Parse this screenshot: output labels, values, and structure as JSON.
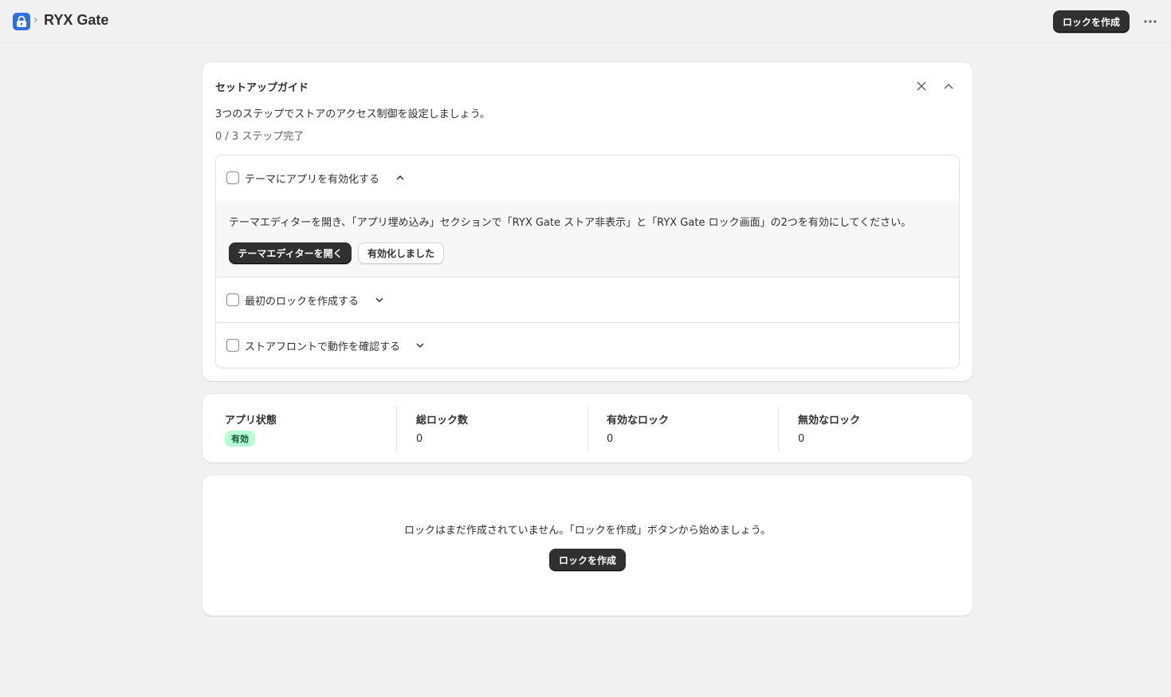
{
  "header": {
    "breadcrumb_separator": "›",
    "app_title": "RYX Gate",
    "create_lock_label": "ロックを作成",
    "more_label": "⋯"
  },
  "setup_guide": {
    "title": "セットアップガイド",
    "description": "3つのステップでストアのアクセス制御を設定しましょう。",
    "progress": "0 / 3 ステップ完了",
    "steps": [
      {
        "label": "テーマにアプリを有効化する",
        "expanded": true,
        "body": "テーマエディターを開き、「アプリ埋め込み」セクションで「RYX Gate ストア非表示」と「RYX Gate ロック画面」の2つを有効にしてください。",
        "primary_action": "テーマエディターを開く",
        "secondary_action": "有効化しました"
      },
      {
        "label": "最初のロックを作成する",
        "expanded": false
      },
      {
        "label": "ストアフロントで動作を確認する",
        "expanded": false
      }
    ]
  },
  "stats": [
    {
      "label": "アプリ状態",
      "badge": "有効"
    },
    {
      "label": "総ロック数",
      "value": "0"
    },
    {
      "label": "有効なロック",
      "value": "0"
    },
    {
      "label": "無効なロック",
      "value": "0"
    }
  ],
  "empty_state": {
    "message": "ロックはまだ作成されていません。「ロックを作成」ボタンから始めましょう。",
    "create_lock_label": "ロックを作成"
  },
  "colors": {
    "accent_dark": "#303030",
    "badge_bg": "#b4fed2",
    "app_icon": "#2f6fe0"
  }
}
